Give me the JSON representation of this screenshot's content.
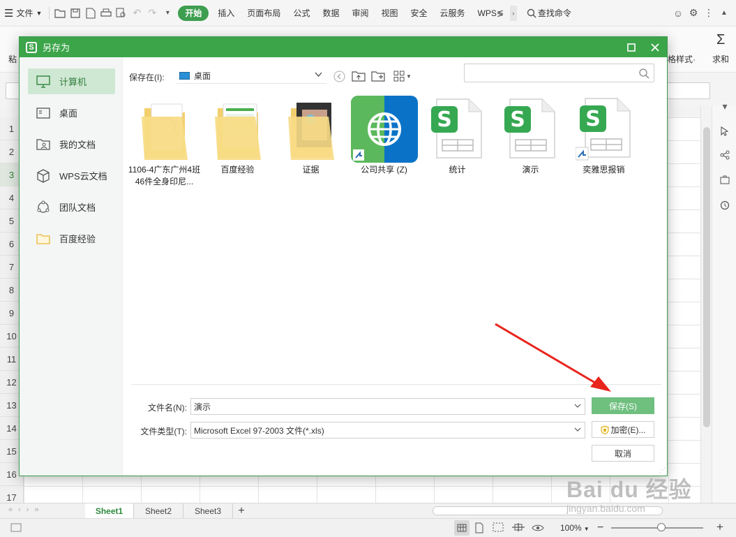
{
  "topbar": {
    "menu_label": "文件",
    "tabs": [
      "开始",
      "插入",
      "页面布局",
      "公式",
      "数据",
      "审阅",
      "视图",
      "安全",
      "云服务",
      "WPS≶"
    ],
    "search_label": "查找命令"
  },
  "ribbon": {
    "paste_label": "粘",
    "style_label": "格样式·",
    "sum_label": "求和"
  },
  "sheet": {
    "row_numbers": [
      "1",
      "2",
      "3",
      "4",
      "5",
      "6",
      "7",
      "8",
      "9",
      "10",
      "11",
      "12",
      "13",
      "14",
      "15",
      "16",
      "17"
    ],
    "tabs": [
      "Sheet1",
      "Sheet2",
      "Sheet3"
    ],
    "add_tab": "+",
    "zoom": "100%"
  },
  "dialog": {
    "title": "另存为",
    "sidebar": [
      {
        "label": "计算机",
        "icon": "monitor-icon",
        "active": true
      },
      {
        "label": "桌面",
        "icon": "desktop-icon",
        "active": false
      },
      {
        "label": "我的文档",
        "icon": "my-documents-icon",
        "active": false
      },
      {
        "label": "WPS云文档",
        "icon": "cube-icon",
        "active": false
      },
      {
        "label": "团队文档",
        "icon": "team-icon",
        "active": false
      },
      {
        "label": "百度经验",
        "icon": "folder-icon",
        "active": false
      }
    ],
    "location_label": "保存在(I):",
    "location_value": "桌面",
    "files": [
      {
        "name": "1106-4广东广州4班46件全身印尼...",
        "type": "folder"
      },
      {
        "name": "百度经验",
        "type": "folder"
      },
      {
        "name": "证据",
        "type": "folder"
      },
      {
        "name": "公司共享 (Z)",
        "type": "network-drive"
      },
      {
        "name": "统计",
        "type": "wps-sheet"
      },
      {
        "name": "演示",
        "type": "wps-sheet"
      },
      {
        "name": "奕雅思报销",
        "type": "wps-sheet-shortcut"
      }
    ],
    "filename_label": "文件名(N):",
    "filename_value": "演示",
    "filetype_label": "文件类型(T):",
    "filetype_value": "Microsoft Excel 97-2003 文件(*.xls)",
    "save_button": "保存(S)",
    "encrypt_button": "加密(E)...",
    "cancel_button": "取消"
  },
  "watermark": {
    "line1": "Bai du 经验",
    "line2": "jingyan.baidu.com"
  },
  "colors": {
    "accent": "#3ca54a",
    "save_button": "#6fbf7f",
    "arrow": "#e8241c"
  }
}
